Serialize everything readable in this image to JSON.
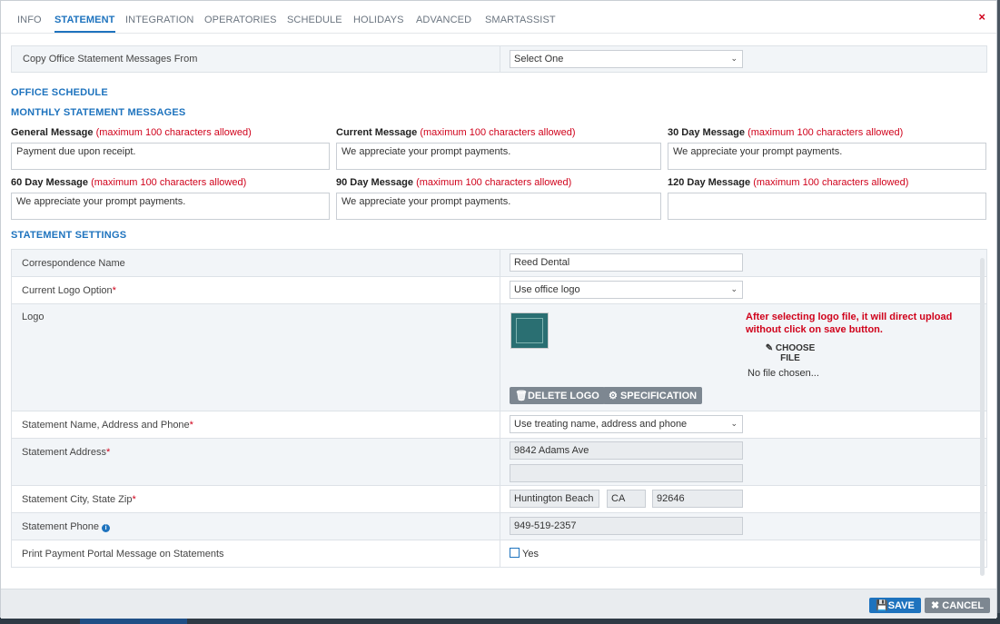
{
  "tabs": [
    {
      "label": "INFO"
    },
    {
      "label": "STATEMENT"
    },
    {
      "label": "INTEGRATION"
    },
    {
      "label": "OPERATORIES"
    },
    {
      "label": "SCHEDULE"
    },
    {
      "label": "HOLIDAYS"
    },
    {
      "label": "ADVANCED"
    },
    {
      "label": "SMARTASSIST"
    }
  ],
  "active_tab": "STATEMENT",
  "close_label": "×",
  "copy_from": {
    "label": "Copy Office Statement Messages From",
    "value": "Select One"
  },
  "sections": {
    "office_schedule": "OFFICE SCHEDULE",
    "monthly_messages": "MONTHLY STATEMENT MESSAGES",
    "statement_settings": "STATEMENT SETTINGS"
  },
  "messages": [
    {
      "label": "General Message",
      "note": "(maximum 100 characters allowed)",
      "value": "Payment due upon receipt."
    },
    {
      "label": "Current Message",
      "note": "(maximum 100 characters allowed)",
      "value": "We appreciate your prompt payments."
    },
    {
      "label": "30 Day Message",
      "note": "(maximum 100 characters allowed)",
      "value": "We appreciate your prompt payments."
    },
    {
      "label": "60 Day Message",
      "note": "(maximum 100 characters allowed)",
      "value": "We appreciate your prompt payments."
    },
    {
      "label": "90 Day Message",
      "note": "(maximum 100 characters allowed)",
      "value": "We appreciate your prompt payments."
    },
    {
      "label": "120 Day Message",
      "note": "(maximum 100 characters allowed)",
      "value": ""
    }
  ],
  "settings": {
    "correspondence_name": {
      "label": "Correspondence Name",
      "value": "Reed Dental"
    },
    "logo_option": {
      "label": "Current Logo Option",
      "required": "*",
      "value": "Use office logo"
    },
    "logo": {
      "label": "Logo",
      "warning": "After selecting logo file, it will direct upload without click on save button.",
      "choose_file": "CHOOSE FILE",
      "no_file": "No file chosen...",
      "delete_label": "DELETE LOGO",
      "spec_label": "SPECIFICATION"
    },
    "name_address_phone": {
      "label": "Statement Name, Address and Phone",
      "required": "*",
      "value": "Use treating name, address and phone"
    },
    "address": {
      "label": "Statement Address",
      "required": "*",
      "line1": "9842 Adams Ave",
      "line2": ""
    },
    "city_state_zip": {
      "label": "Statement City, State Zip",
      "required": "*",
      "city": "Huntington Beach",
      "state": "CA",
      "zip": "92646"
    },
    "phone": {
      "label": "Statement Phone",
      "value": "949-519-2357"
    },
    "portal_message": {
      "label": "Print Payment Portal Message on Statements",
      "checkbox_label": "Yes",
      "checked": false
    }
  },
  "footer": {
    "save_label": "SAVE",
    "cancel_label": "CANCEL"
  },
  "colors": {
    "accent": "#1e73be",
    "required": "#d0021b",
    "neutral_button": "#7d8791"
  }
}
